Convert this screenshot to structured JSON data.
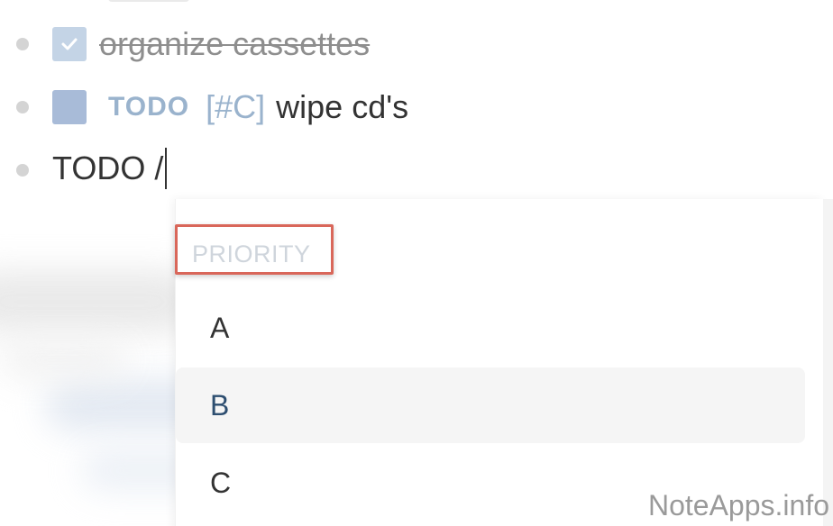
{
  "blocks": {
    "done": {
      "text": "organize cassettes",
      "checked": true,
      "checkmark": "✔"
    },
    "todo": {
      "marker": "TODO",
      "priority": "[#C]",
      "text": "wipe cd's",
      "checked": false
    },
    "input": {
      "text": "TODO /"
    }
  },
  "popup": {
    "section_label": "PRIORITY",
    "options": [
      {
        "label": "A"
      },
      {
        "label": "B",
        "highlighted": true
      },
      {
        "label": "C"
      }
    ]
  },
  "watermark": "NoteApps.info",
  "colors": {
    "todo_accent": "#9ab3cd",
    "checkbox_checked": "#c4d4e6",
    "checkbox_unchecked": "#a8bbd8",
    "highlight_box": "#d9675a",
    "option_highlight_text": "#2d4e70"
  }
}
